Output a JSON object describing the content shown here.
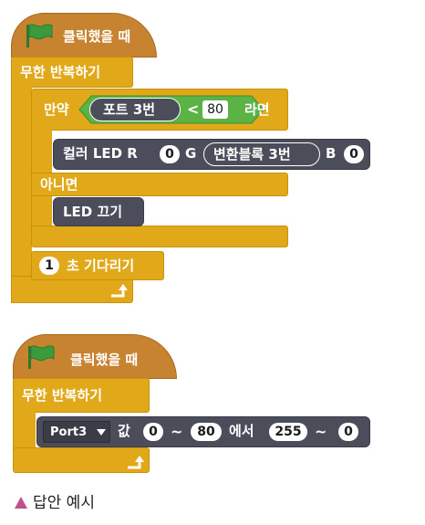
{
  "script1": {
    "hat_label": "클릭했을 때",
    "forever_label": "무한 반복하기",
    "if_label": "만약",
    "sensor_label": "포트 3번",
    "compare_op": "<",
    "compare_value": "80",
    "then_label": "라면",
    "color_led_label": "컬러 LED R",
    "r_value": "0",
    "g_label": "G",
    "reporter_label": "변환블록 3번",
    "b_label": "B",
    "b_value": "0",
    "else_label": "아니면",
    "led_off_label": "LED 끄기",
    "wait_value": "1",
    "wait_label": "초 기다리기"
  },
  "script2": {
    "hat_label": "클릭했을 때",
    "forever_label": "무한 반복하기",
    "port_select": "Port3",
    "value_label": "값",
    "from_low": "0",
    "tilde1": "~",
    "from_high": "80",
    "in_label": "에서",
    "to_low": "255",
    "tilde2": "~",
    "to_high": "0"
  },
  "caption": "답안 예시",
  "colors": {
    "event": "#c88330",
    "control": "#e1a91a",
    "operator": "#5bb346",
    "reporter": "#4b4e5a",
    "caption_marker": "#c2508d",
    "flag": "#3a9a3c"
  },
  "icons": [
    "green-flag-icon",
    "loop-arrow-icon",
    "dropdown-triangle-icon",
    "triangle-marker-icon"
  ]
}
